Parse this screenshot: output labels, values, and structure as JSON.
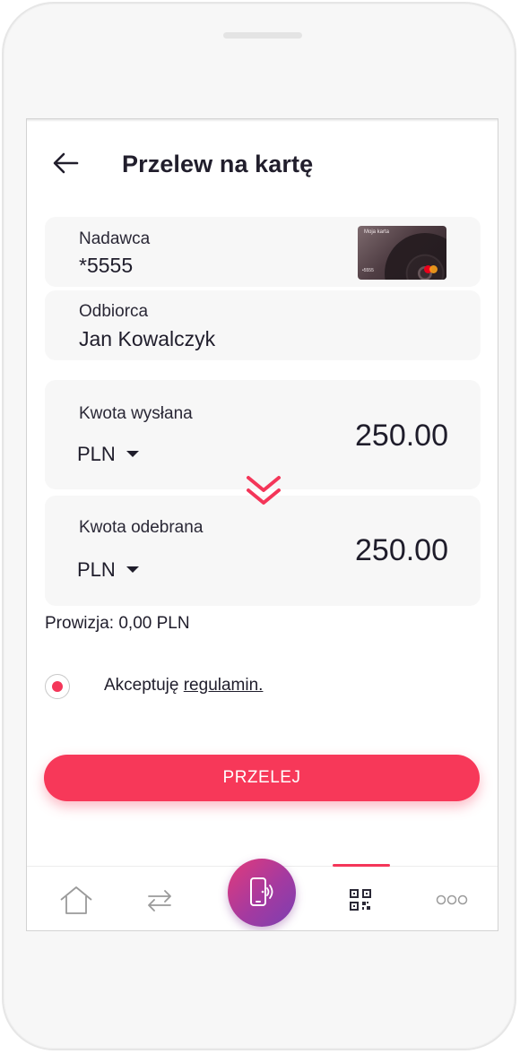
{
  "header": {
    "title": "Przelew na kartę",
    "back_icon": "arrow-left-icon"
  },
  "sender": {
    "label": "Nadawca",
    "value": "*5555",
    "card_thumbnail": {
      "name_text": "Moja karta",
      "number_text": "•5555",
      "network": "mastercard"
    }
  },
  "recipient": {
    "label": "Odbiorca",
    "value": "Jan Kowalczyk"
  },
  "sent": {
    "label": "Kwota wysłana",
    "currency": "PLN",
    "amount": "250.00"
  },
  "received": {
    "label": "Kwota odebrana",
    "currency": "PLN",
    "amount": "250.00"
  },
  "fee_text": "Prowizja: 0,00 PLN",
  "terms": {
    "checked": true,
    "prefix": "Akceptuję ",
    "link": "regulamin."
  },
  "submit_label": "PRZELEJ",
  "tabbar": {
    "items": [
      {
        "icon": "home-icon"
      },
      {
        "icon": "transfer-arrows-icon"
      },
      {
        "icon": "phone-contactless-icon",
        "center": true
      },
      {
        "icon": "qr-code-icon",
        "active": true
      },
      {
        "icon": "more-dots-icon"
      }
    ]
  },
  "colors": {
    "accent": "#f73859",
    "fab_gradient_start": "#e33a7a",
    "fab_gradient_end": "#7b3fb2",
    "title": "#211e2c"
  }
}
